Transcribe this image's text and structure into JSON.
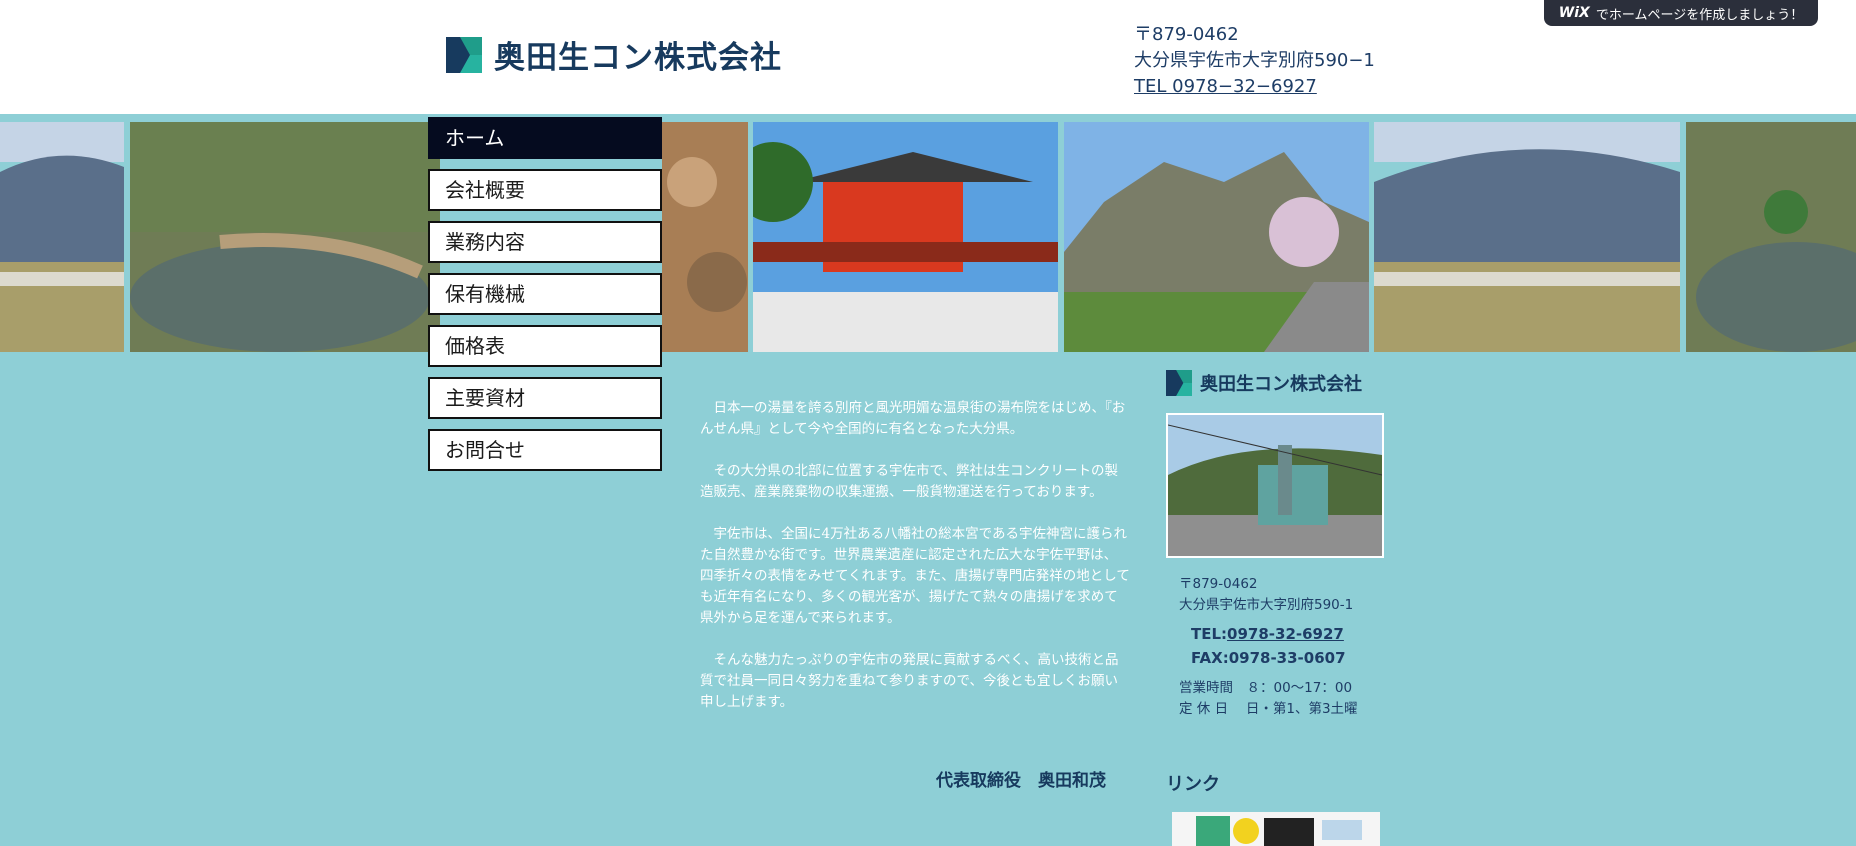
{
  "header": {
    "company_name": "奥田生コン株式会社",
    "postal": "〒879-0462",
    "address": "大分県宇佐市大字別府590−1",
    "tel": "TEL 0978−32−6927"
  },
  "wix_banner": {
    "brand": "WiX",
    "text": "でホームページを作成しましょう！"
  },
  "nav": {
    "items": [
      {
        "label": "ホーム"
      },
      {
        "label": "会社概要"
      },
      {
        "label": "業務内容"
      },
      {
        "label": "保有機械"
      },
      {
        "label": "価格表"
      },
      {
        "label": "主要資材"
      },
      {
        "label": "お問合せ"
      }
    ]
  },
  "intro": {
    "paragraphs": [
      "　日本一の湯量を誇る別府と風光明媚な温泉街の湯布院をはじめ、『おんせん県』として今や全国的に有名となった大分県。",
      "　その大分県の北部に位置する宇佐市で、弊社は生コンクリートの製造販売、産業廃棄物の収集運搬、一般貨物運送を行っております。",
      "　宇佐市は、全国に4万社ある八幡社の総本宮である宇佐神宮に護られた自然豊かな街です。世界農業遺産に認定された広大な宇佐平野は、四季折々の表情をみせてくれます。また、唐揚げ専門店発祥の地としても近年有名になり、多くの観光客が、揚げたて熱々の唐揚げを求めて県外から足を運んで来られます。",
      "　そんな魅力たっぷりの宇佐市の発展に貢献するべく、高い技術と品質で社員一同日々努力を重ねて参りますので、今後とも宜しくお願い申し上げます。"
    ],
    "president": "代表取締役　奥田和茂"
  },
  "sidebar": {
    "company_name": "奥田生コン株式会社",
    "postal": "〒879-0462",
    "address": "大分県宇佐市大字別府590-1",
    "tel_label": "TEL:",
    "tel": "0978-32-6927",
    "fax": "FAX:0978-33-0607",
    "hours": "営業時間　８：00〜17：00",
    "holidays": "定 休 日　 日・第1、第3土曜",
    "links_title": "リンク"
  },
  "colors": {
    "background": "#8ecfd6",
    "navy": "#173a5e",
    "logo_green": "#1f9d8a",
    "nav_active": "#050b1f"
  },
  "icons": [
    "company-logo-icon"
  ]
}
